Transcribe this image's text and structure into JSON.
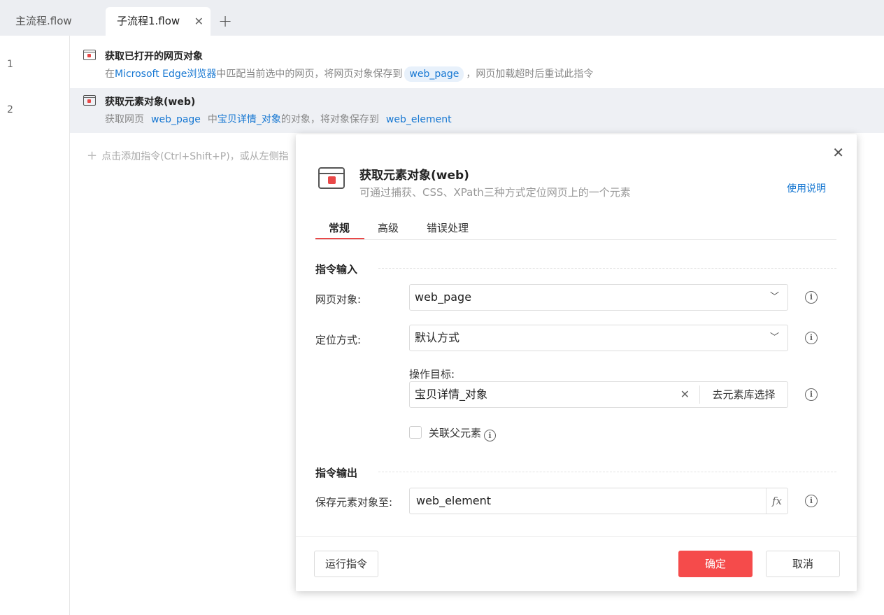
{
  "tabs": [
    {
      "label": "主流程.flow"
    },
    {
      "label": "子流程1.flow",
      "close": "✕"
    }
  ],
  "tab_add": "+",
  "editor": {
    "lines": [
      {
        "num": "1",
        "title": "获取已打开的网页对象",
        "desc": {
          "p1": "在",
          "browser": "Microsoft Edge浏览器",
          "p2": "中匹配当前选中的网页，将网页对象保存到",
          "var": "web_page",
          "p3": "，网页加载超时后重试此指令"
        }
      },
      {
        "num": "2",
        "title": "获取元素对象(web)",
        "desc": {
          "p1": "获取网页",
          "var1": "web_page",
          "p2": "中",
          "obj": "宝贝详情_对象",
          "p3": "的对象，将对象保存到",
          "var2": "web_element"
        }
      }
    ],
    "add_hint": "点击添加指令(Ctrl+Shift+P)，或从左侧指"
  },
  "dialog": {
    "close": "✕",
    "title": "获取元素对象(web)",
    "subtitle": "可通过捕获、CSS、XPath三种方式定位网页上的一个元素",
    "help": "使用说明",
    "tabs": [
      "常规",
      "高级",
      "错误处理"
    ],
    "input_section": "指令输入",
    "fields": {
      "page_label": "网页对象:",
      "page_value": "web_page",
      "locate_label": "定位方式:",
      "locate_value": "默认方式",
      "target_label": "操作目标:",
      "target_value": "宝贝详情_对象",
      "target_clear": "✕",
      "target_lib": "去元素库选择",
      "link_parent": "关联父元素"
    },
    "output_section": "指令输出",
    "output": {
      "label": "保存元素对象至:",
      "value": "web_element",
      "fx": "fx"
    },
    "buttons": {
      "run": "运行指令",
      "ok": "确定",
      "cancel": "取消"
    }
  },
  "colors": {
    "accent": "#f54b4b",
    "link": "#1677d2",
    "tab_bar": "#eceef2",
    "selected_row": "#eef0f4"
  }
}
